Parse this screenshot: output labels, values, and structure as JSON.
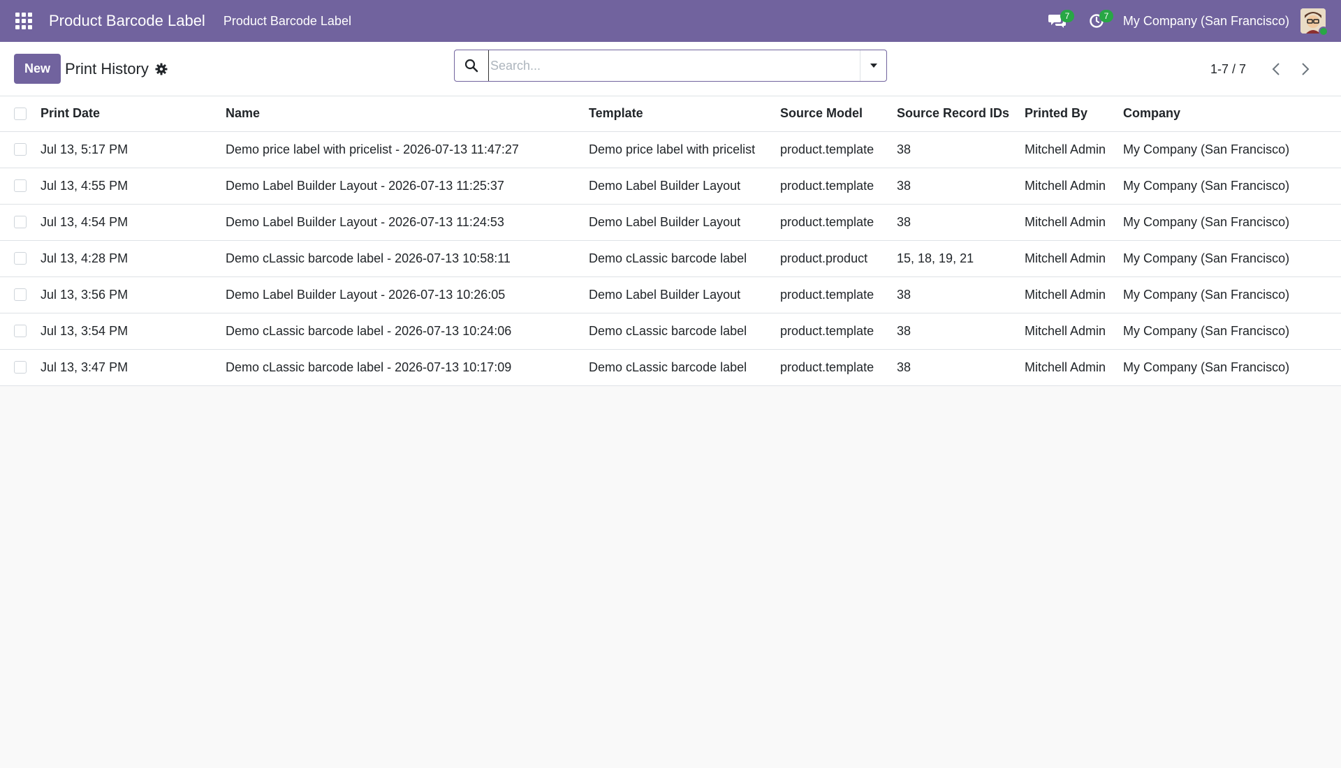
{
  "navbar": {
    "app_title": "Product Barcode Label",
    "menu_item": "Product Barcode Label",
    "messages_badge": "7",
    "activities_badge": "7",
    "company": "My Company (San Francisco)"
  },
  "control_panel": {
    "new_label": "New",
    "breadcrumb": "Print History",
    "search_placeholder": "Search...",
    "pager": "1-7 / 7"
  },
  "table": {
    "columns": [
      "Print Date",
      "Name",
      "Template",
      "Source Model",
      "Source Record IDs",
      "Printed By",
      "Company"
    ],
    "rows": [
      [
        "Jul 13, 5:17 PM",
        "Demo price label with pricelist - 2026-07-13 11:47:27",
        "Demo price label with pricelist",
        "product.template",
        "38",
        "Mitchell Admin",
        "My Company (San Francisco)"
      ],
      [
        "Jul 13, 4:55 PM",
        "Demo Label Builder Layout - 2026-07-13 11:25:37",
        "Demo Label Builder Layout",
        "product.template",
        "38",
        "Mitchell Admin",
        "My Company (San Francisco)"
      ],
      [
        "Jul 13, 4:54 PM",
        "Demo Label Builder Layout - 2026-07-13 11:24:53",
        "Demo Label Builder Layout",
        "product.template",
        "38",
        "Mitchell Admin",
        "My Company (San Francisco)"
      ],
      [
        "Jul 13, 4:28 PM",
        "Demo cLassic barcode label - 2026-07-13 10:58:11",
        "Demo cLassic barcode label",
        "product.product",
        "15, 18, 19, 21",
        "Mitchell Admin",
        "My Company (San Francisco)"
      ],
      [
        "Jul 13, 3:56 PM",
        "Demo Label Builder Layout - 2026-07-13 10:26:05",
        "Demo Label Builder Layout",
        "product.template",
        "38",
        "Mitchell Admin",
        "My Company (San Francisco)"
      ],
      [
        "Jul 13, 3:54 PM",
        "Demo cLassic barcode label - 2026-07-13 10:24:06",
        "Demo cLassic barcode label",
        "product.template",
        "38",
        "Mitchell Admin",
        "My Company (San Francisco)"
      ],
      [
        "Jul 13, 3:47 PM",
        "Demo cLassic barcode label - 2026-07-13 10:17:09",
        "Demo cLassic barcode label",
        "product.template",
        "38",
        "Mitchell Admin",
        "My Company (San Francisco)"
      ]
    ]
  },
  "colors": {
    "brand": "#71639e",
    "badge": "#28a745"
  },
  "icons": {
    "apps": "apps-grid-icon",
    "messages": "chat-bubbles-icon",
    "activities": "clock-icon",
    "settings": "gear-icon",
    "search": "search-icon",
    "toggle": "caret-down-icon",
    "prev": "chevron-left-icon",
    "next": "chevron-right-icon"
  }
}
